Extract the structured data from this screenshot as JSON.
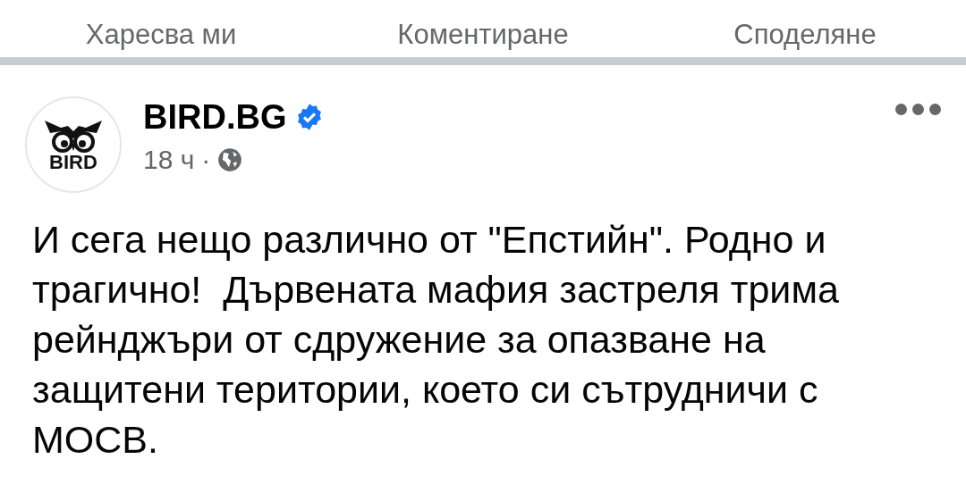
{
  "actions": [
    {
      "label": "Харесва ми"
    },
    {
      "label": "Коментиране"
    },
    {
      "label": "Споделяне"
    }
  ],
  "post": {
    "avatar_text": "BIRD",
    "author": "BIRD.BG",
    "verified": true,
    "time": "18 ч",
    "separator": "·",
    "public": true,
    "text": "И сега нещо различно от \"Епстийн\". Родно и трагично!  Дървената мафия застреля трима рейнджъри от сдружение за опазване на защитени територии, което си сътрудничи с МОСВ."
  }
}
